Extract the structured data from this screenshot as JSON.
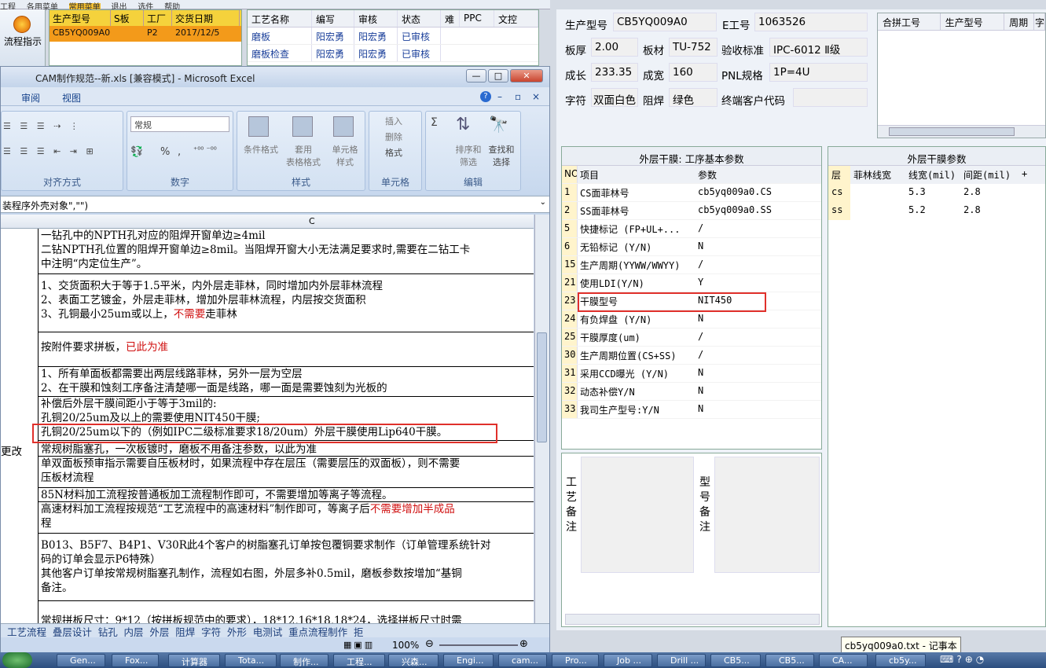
{
  "host": {
    "menu": [
      "工程",
      "各用菜单",
      "常用菜单",
      "退出",
      "选件",
      "帮助"
    ],
    "flow_button": "流程指示",
    "order_headers": [
      "生产型号",
      "S板",
      "工厂",
      "交货日期"
    ],
    "order_row": [
      "CB5YQ009A0",
      "",
      "P2",
      "2017/12/5"
    ],
    "process_headers": [
      "工艺名称",
      "编写",
      "审核",
      "状态",
      "难",
      "PPC",
      "文控"
    ],
    "process_rows": [
      [
        "磨板",
        "阳宏勇",
        "阳宏勇",
        "已审核"
      ],
      [
        "磨板检查",
        "阳宏勇",
        "阳宏勇",
        "已审核"
      ]
    ]
  },
  "excel": {
    "title": "CAM制作规范--新.xls  [兼容模式] - Microsoft Excel",
    "window_buttons": [
      "—",
      "□",
      "✕"
    ],
    "menu": [
      "审阅",
      "视图"
    ],
    "ribbon": {
      "format_dropdown": "常规",
      "groups": [
        "对齐方式",
        "数字",
        "样式",
        "单元格",
        "编辑"
      ],
      "style_buttons": [
        "条件格式",
        "套用\n表格格式",
        "单元格\n样式"
      ],
      "cell_buttons": [
        "插入",
        "删除",
        "格式"
      ],
      "edit_buttons": [
        "排序和\n筛选",
        "查找和\n选择"
      ],
      "number_symbols": [
        "%",
        ","
      ]
    },
    "formula": "装程序外壳对象\",\"\")",
    "column_header": "C",
    "cells": [
      {
        "lines": [
          "一钻孔中的NPTH孔对应的阻焊开窗单边≥4mil",
          "二钻NPTH孔位置的阻焊开窗单边≥8mil。当阻焊开窗大小无法满足要求时,需要在二钻工卡",
          "中注明“内定位生产”。"
        ]
      },
      {
        "lines": [
          "1、交货面积大于等于1.5平米，内外层走菲林，同时增加内外层菲林流程",
          "2、表面工艺镀金，外层走菲林，增加外层菲林流程，内层按交货面积",
          "3、孔铜最小25um或以上，不需要走菲林"
        ],
        "red": "不需要"
      },
      {
        "lines": [
          "按附件要求拼板，已此为准"
        ],
        "red": "已此为准"
      },
      {
        "lines": [
          "1、所有单面板都需要出两层线路菲林，另外一层为空层",
          "2、在干膜和蚀刻工序备注清楚哪一面是线路，哪一面是需要蚀刻为光板的"
        ]
      },
      {
        "lines": [
          "补偿后外层干膜间距小于等于3mil的:",
          "孔铜20/25um及以上的需要使用NIT450干膜;",
          "孔铜20/25um以下的（例如IPC二级标准要求18/20um）外层干膜使用Lip640干膜。"
        ]
      },
      {
        "lines": [
          "常规树脂塞孔，一次板镀时，磨板不用备注参数，以此为准"
        ],
        "left": "更改"
      },
      {
        "lines": [
          "单双面板预审指示需要自压板材时，如果流程中存在层压（需要层压的双面板），则不需要",
          "压板材流程"
        ]
      },
      {
        "lines": [
          "85N材料加工流程按普通板加工流程制作即可，不需要增加等离子等流程。"
        ]
      },
      {
        "lines": [
          "高速材料加工流程按规范“工艺流程中的高速材料”制作即可，等离子后不需要增加半成品",
          "程"
        ],
        "red": "不需要增加半成品"
      },
      {
        "lines": [
          "B013、B5F7、B4P1、V30R此4个客户的树脂塞孔订单按包覆铜要求制作（订单管理系统针对",
          "码的订单会显示P6特殊）",
          "其他客户订单按常规树脂塞孔制作，流程如右图，外层多补0.5mil，磨板参数按增加“基铜",
          "备注。"
        ]
      },
      {
        "lines": [
          "常规拼板尺寸：9*12（按拼板规范中的要求），18*12,16*18,18*24，选择拼板尺寸时需"
        ]
      }
    ],
    "sheet_tabs": [
      "工艺流程",
      "叠层设计",
      "钻孔",
      "内层",
      "外层",
      "阻焊",
      "字符",
      "外形",
      "电测试",
      "重点流程制作",
      "拒"
    ],
    "zoom": "100%"
  },
  "right": {
    "fields": {
      "prod_model_label": "生产型号",
      "prod_model": "CB5YQ009A0",
      "e_no_label": "E工号",
      "e_no": "1063526",
      "thickness_label": "板厚",
      "thickness": "2.00",
      "material_label": "板材",
      "material": "TU-752",
      "std_label": "验收标准",
      "std": "IPC-6012 Ⅱ级",
      "length_label": "成长",
      "length": "233.35",
      "width_label": "成宽",
      "width": "160",
      "pnl_label": "PNL规格",
      "pnl": "1P=4U",
      "char_label": "字符",
      "char": "双面白色",
      "mask_label": "阻焊",
      "mask": "绿色",
      "customer_label": "终端客户代码",
      "customer": ""
    },
    "merge_headers": [
      "合拼工号",
      "生产型号",
      "周期",
      "字"
    ],
    "basic_title": "外层干膜: 工序基本参数",
    "basic_headers": [
      "NO",
      "项目",
      "参数"
    ],
    "basic_rows": [
      [
        "1",
        "CS面菲林号",
        "cb5yq009a0.CS"
      ],
      [
        "2",
        "SS面菲林号",
        "cb5yq009a0.SS"
      ],
      [
        "5",
        "快捷标记 (FP+UL+...",
        "/"
      ],
      [
        "6",
        "无铅标记 (Y/N)",
        "N"
      ],
      [
        "15",
        "生产周期(YYWW/WWYY)",
        "/"
      ],
      [
        "21",
        "使用LDI(Y/N)",
        "Y"
      ],
      [
        "23",
        "干膜型号",
        "NIT450"
      ],
      [
        "24",
        "有负焊盘 (Y/N)",
        "N"
      ],
      [
        "25",
        "干膜厚度(um)",
        "/"
      ],
      [
        "30",
        "生产周期位置(CS+SS)",
        "/"
      ],
      [
        "31",
        "采用CCD曝光 (Y/N)",
        "N"
      ],
      [
        "32",
        "动态补偿Y/N",
        "N"
      ],
      [
        "33",
        "我司生产型号:Y/N",
        "N"
      ]
    ],
    "ext_title": "外层干膜参数",
    "ext_headers": [
      "层",
      "菲林线宽",
      "线宽(mil)",
      "间距(mil)",
      "+"
    ],
    "ext_rows": [
      [
        "cs",
        "",
        "5.3",
        "2.8"
      ],
      [
        "ss",
        "",
        "5.2",
        "2.8"
      ]
    ],
    "notes_process_label": "工艺备注",
    "notes_model_label": "型号备注"
  },
  "tooltip": "cb5yq009a0.txt - 记事本",
  "taskbar": [
    "Gen...",
    "Fox...",
    "计算器",
    "Tota...",
    "制作...",
    "工程...",
    "兴森...",
    "Engi...",
    "cam...",
    "Pro...",
    "Job ...",
    "Drill ...",
    "CB5...",
    "CB5...",
    "CA...",
    "cb5y..."
  ],
  "colors": {
    "highlight": "#e0302b",
    "accent": "#f39a1a",
    "header_yellow": "#f5d23c"
  }
}
